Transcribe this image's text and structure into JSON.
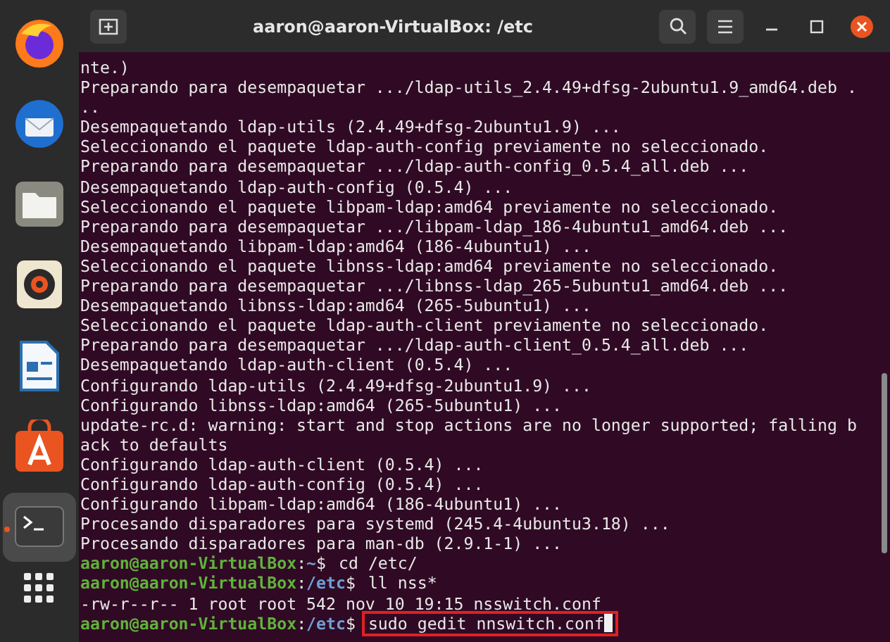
{
  "window": {
    "title": "aaron@aaron-VirtualBox: /etc"
  },
  "dock": [
    {
      "kind": "firefox",
      "running": false
    },
    {
      "kind": "mail",
      "running": false
    },
    {
      "kind": "files",
      "running": false
    },
    {
      "kind": "music",
      "running": false
    },
    {
      "kind": "writer",
      "running": false
    },
    {
      "kind": "store",
      "running": false
    },
    {
      "kind": "terminal",
      "running": true
    }
  ],
  "terminal_lines": [
    {
      "kind": "text",
      "text": "nte.)"
    },
    {
      "kind": "text",
      "text": "Preparando para desempaquetar .../ldap-utils_2.4.49+dfsg-2ubuntu1.9_amd64.deb ."
    },
    {
      "kind": "text",
      "text": ".."
    },
    {
      "kind": "text",
      "text": "Desempaquetando ldap-utils (2.4.49+dfsg-2ubuntu1.9) ..."
    },
    {
      "kind": "text",
      "text": "Seleccionando el paquete ldap-auth-config previamente no seleccionado."
    },
    {
      "kind": "text",
      "text": "Preparando para desempaquetar .../ldap-auth-config_0.5.4_all.deb ..."
    },
    {
      "kind": "text",
      "text": "Desempaquetando ldap-auth-config (0.5.4) ..."
    },
    {
      "kind": "text",
      "text": "Seleccionando el paquete libpam-ldap:amd64 previamente no seleccionado."
    },
    {
      "kind": "text",
      "text": "Preparando para desempaquetar .../libpam-ldap_186-4ubuntu1_amd64.deb ..."
    },
    {
      "kind": "text",
      "text": "Desempaquetando libpam-ldap:amd64 (186-4ubuntu1) ..."
    },
    {
      "kind": "text",
      "text": "Seleccionando el paquete libnss-ldap:amd64 previamente no seleccionado."
    },
    {
      "kind": "text",
      "text": "Preparando para desempaquetar .../libnss-ldap_265-5ubuntu1_amd64.deb ..."
    },
    {
      "kind": "text",
      "text": "Desempaquetando libnss-ldap:amd64 (265-5ubuntu1) ..."
    },
    {
      "kind": "text",
      "text": "Seleccionando el paquete ldap-auth-client previamente no seleccionado."
    },
    {
      "kind": "text",
      "text": "Preparando para desempaquetar .../ldap-auth-client_0.5.4_all.deb ..."
    },
    {
      "kind": "text",
      "text": "Desempaquetando ldap-auth-client (0.5.4) ..."
    },
    {
      "kind": "text",
      "text": "Configurando ldap-utils (2.4.49+dfsg-2ubuntu1.9) ..."
    },
    {
      "kind": "text",
      "text": "Configurando libnss-ldap:amd64 (265-5ubuntu1) ..."
    },
    {
      "kind": "text",
      "text": "update-rc.d: warning: start and stop actions are no longer supported; falling b"
    },
    {
      "kind": "text",
      "text": "ack to defaults"
    },
    {
      "kind": "text",
      "text": "Configurando ldap-auth-client (0.5.4) ..."
    },
    {
      "kind": "text",
      "text": "Configurando ldap-auth-config (0.5.4) ..."
    },
    {
      "kind": "text",
      "text": "Configurando libpam-ldap:amd64 (186-4ubuntu1) ..."
    },
    {
      "kind": "text",
      "text": "Procesando disparadores para systemd (245.4-4ubuntu3.18) ..."
    },
    {
      "kind": "text",
      "text": "Procesando disparadores para man-db (2.9.1-1) ..."
    },
    {
      "kind": "prompt",
      "user": "aaron@aaron-VirtualBox",
      "separator": ":",
      "path": "~",
      "sign": "$",
      "command": "cd /etc/",
      "highlighted": false
    },
    {
      "kind": "prompt",
      "user": "aaron@aaron-VirtualBox",
      "separator": ":",
      "path": "/etc",
      "sign": "$",
      "command": "ll nss*",
      "highlighted": false
    },
    {
      "kind": "text",
      "text": "-rw-r--r-- 1 root root 542 nov 10 19:15 nsswitch.conf"
    },
    {
      "kind": "prompt",
      "user": "aaron@aaron-VirtualBox",
      "separator": ":",
      "path": "/etc",
      "sign": "$",
      "command": "sudo gedit nnswitch.conf",
      "highlighted": true
    }
  ]
}
